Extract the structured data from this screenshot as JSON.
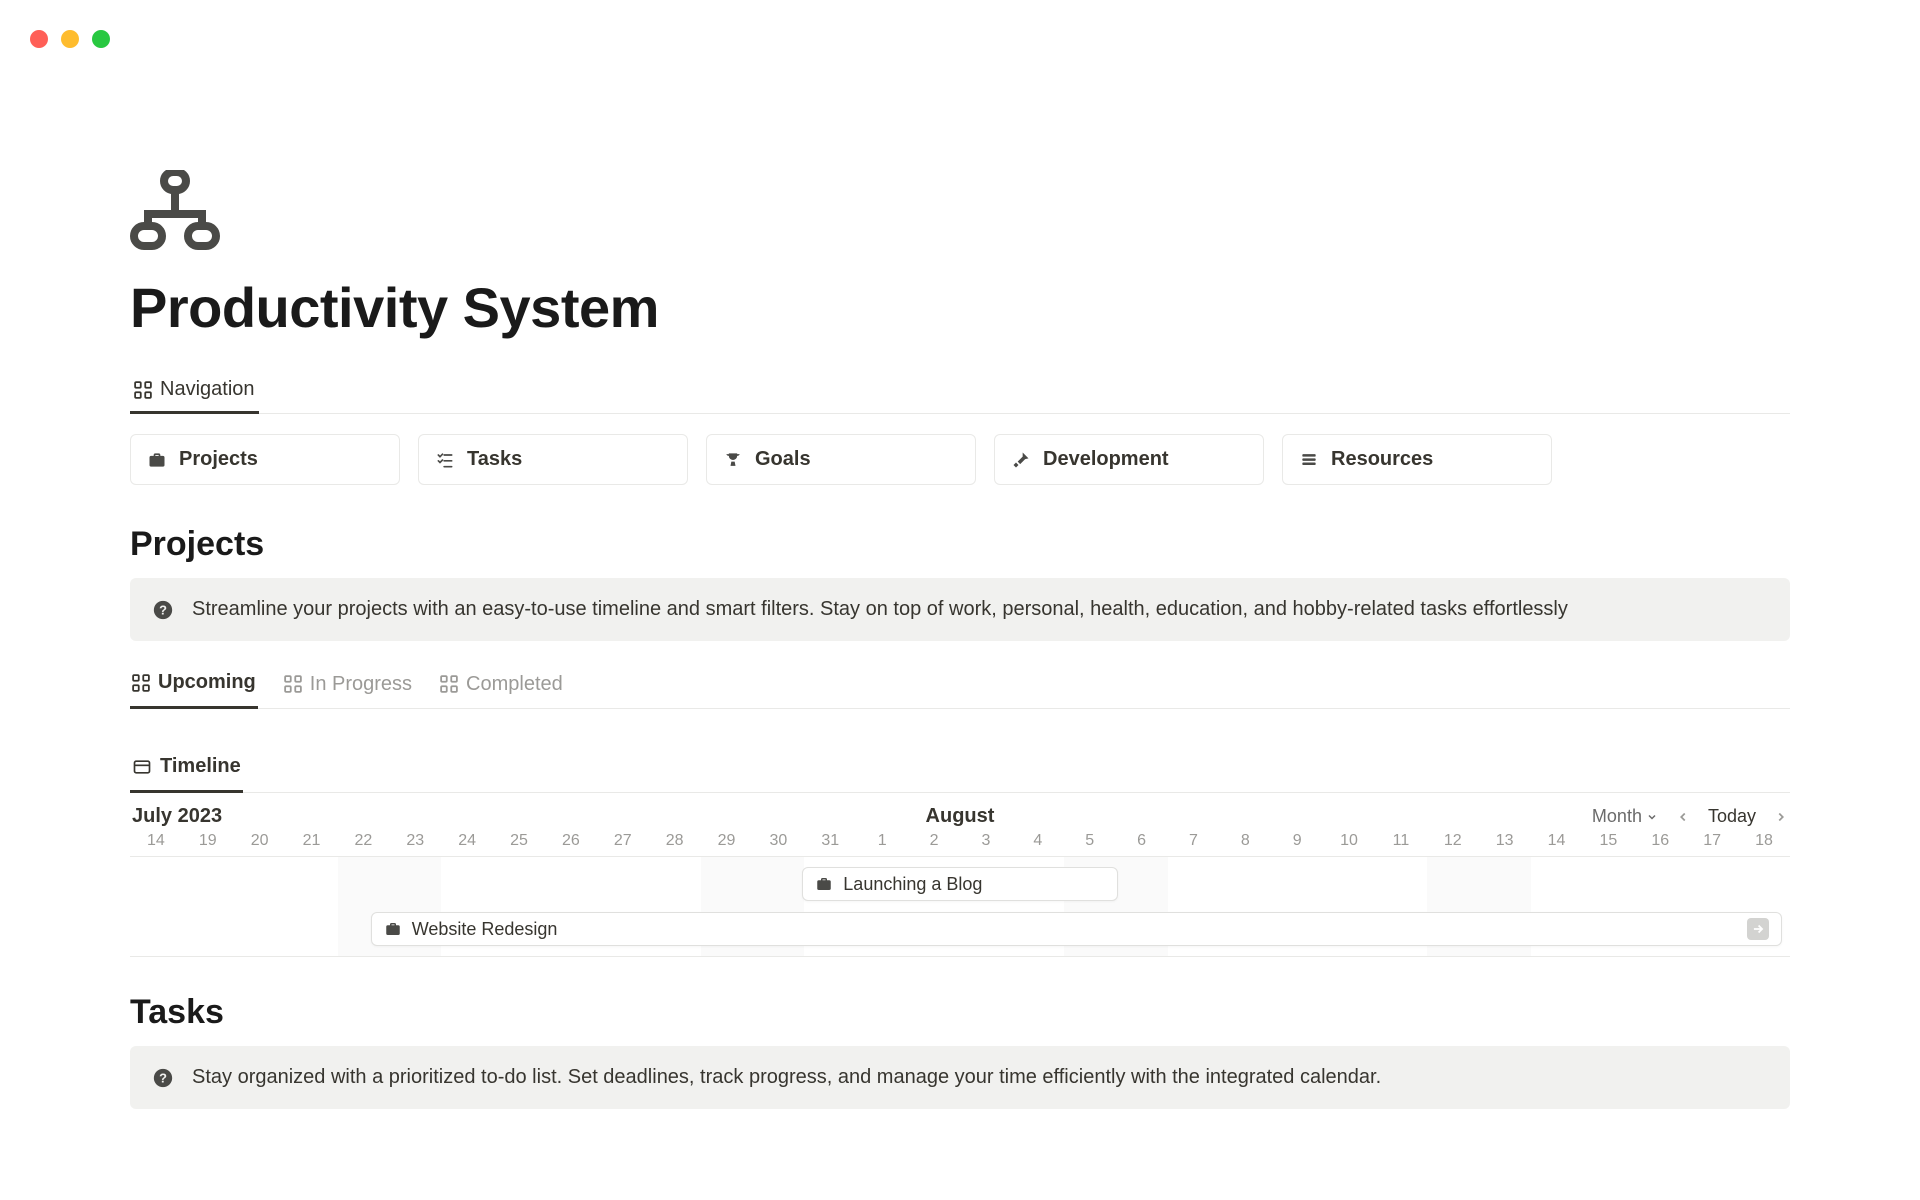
{
  "page": {
    "title": "Productivity System"
  },
  "nav": {
    "tab_label": "Navigation",
    "cards": [
      {
        "label": "Projects",
        "icon": "briefcase"
      },
      {
        "label": "Tasks",
        "icon": "checklist"
      },
      {
        "label": "Goals",
        "icon": "trophy"
      },
      {
        "label": "Development",
        "icon": "tool"
      },
      {
        "label": "Resources",
        "icon": "stack"
      }
    ]
  },
  "projects": {
    "title": "Projects",
    "callout": "Streamline your projects with an easy-to-use timeline and smart filters. Stay on top of work, personal, health, education, and hobby-related tasks effortlessly",
    "filters": [
      {
        "label": "Upcoming",
        "active": true
      },
      {
        "label": "In Progress",
        "active": false
      },
      {
        "label": "Completed",
        "active": false
      }
    ],
    "timeline": {
      "tab_label": "Timeline",
      "left_label": "July 2023",
      "center_label": "August",
      "scale_label": "Month",
      "today_label": "Today",
      "days": [
        "14",
        "19",
        "20",
        "21",
        "22",
        "23",
        "24",
        "25",
        "26",
        "27",
        "28",
        "29",
        "30",
        "31",
        "1",
        "2",
        "3",
        "4",
        "5",
        "6",
        "7",
        "8",
        "9",
        "10",
        "11",
        "12",
        "13",
        "14",
        "15",
        "16",
        "17",
        "18"
      ],
      "bars": [
        {
          "label": "Launching a Blog",
          "icon": "briefcase"
        },
        {
          "label": "Website Redesign",
          "icon": "briefcase"
        }
      ]
    }
  },
  "tasks": {
    "title": "Tasks",
    "callout": "Stay organized with a prioritized to-do list. Set deadlines, track progress, and manage your time efficiently with the integrated calendar."
  }
}
